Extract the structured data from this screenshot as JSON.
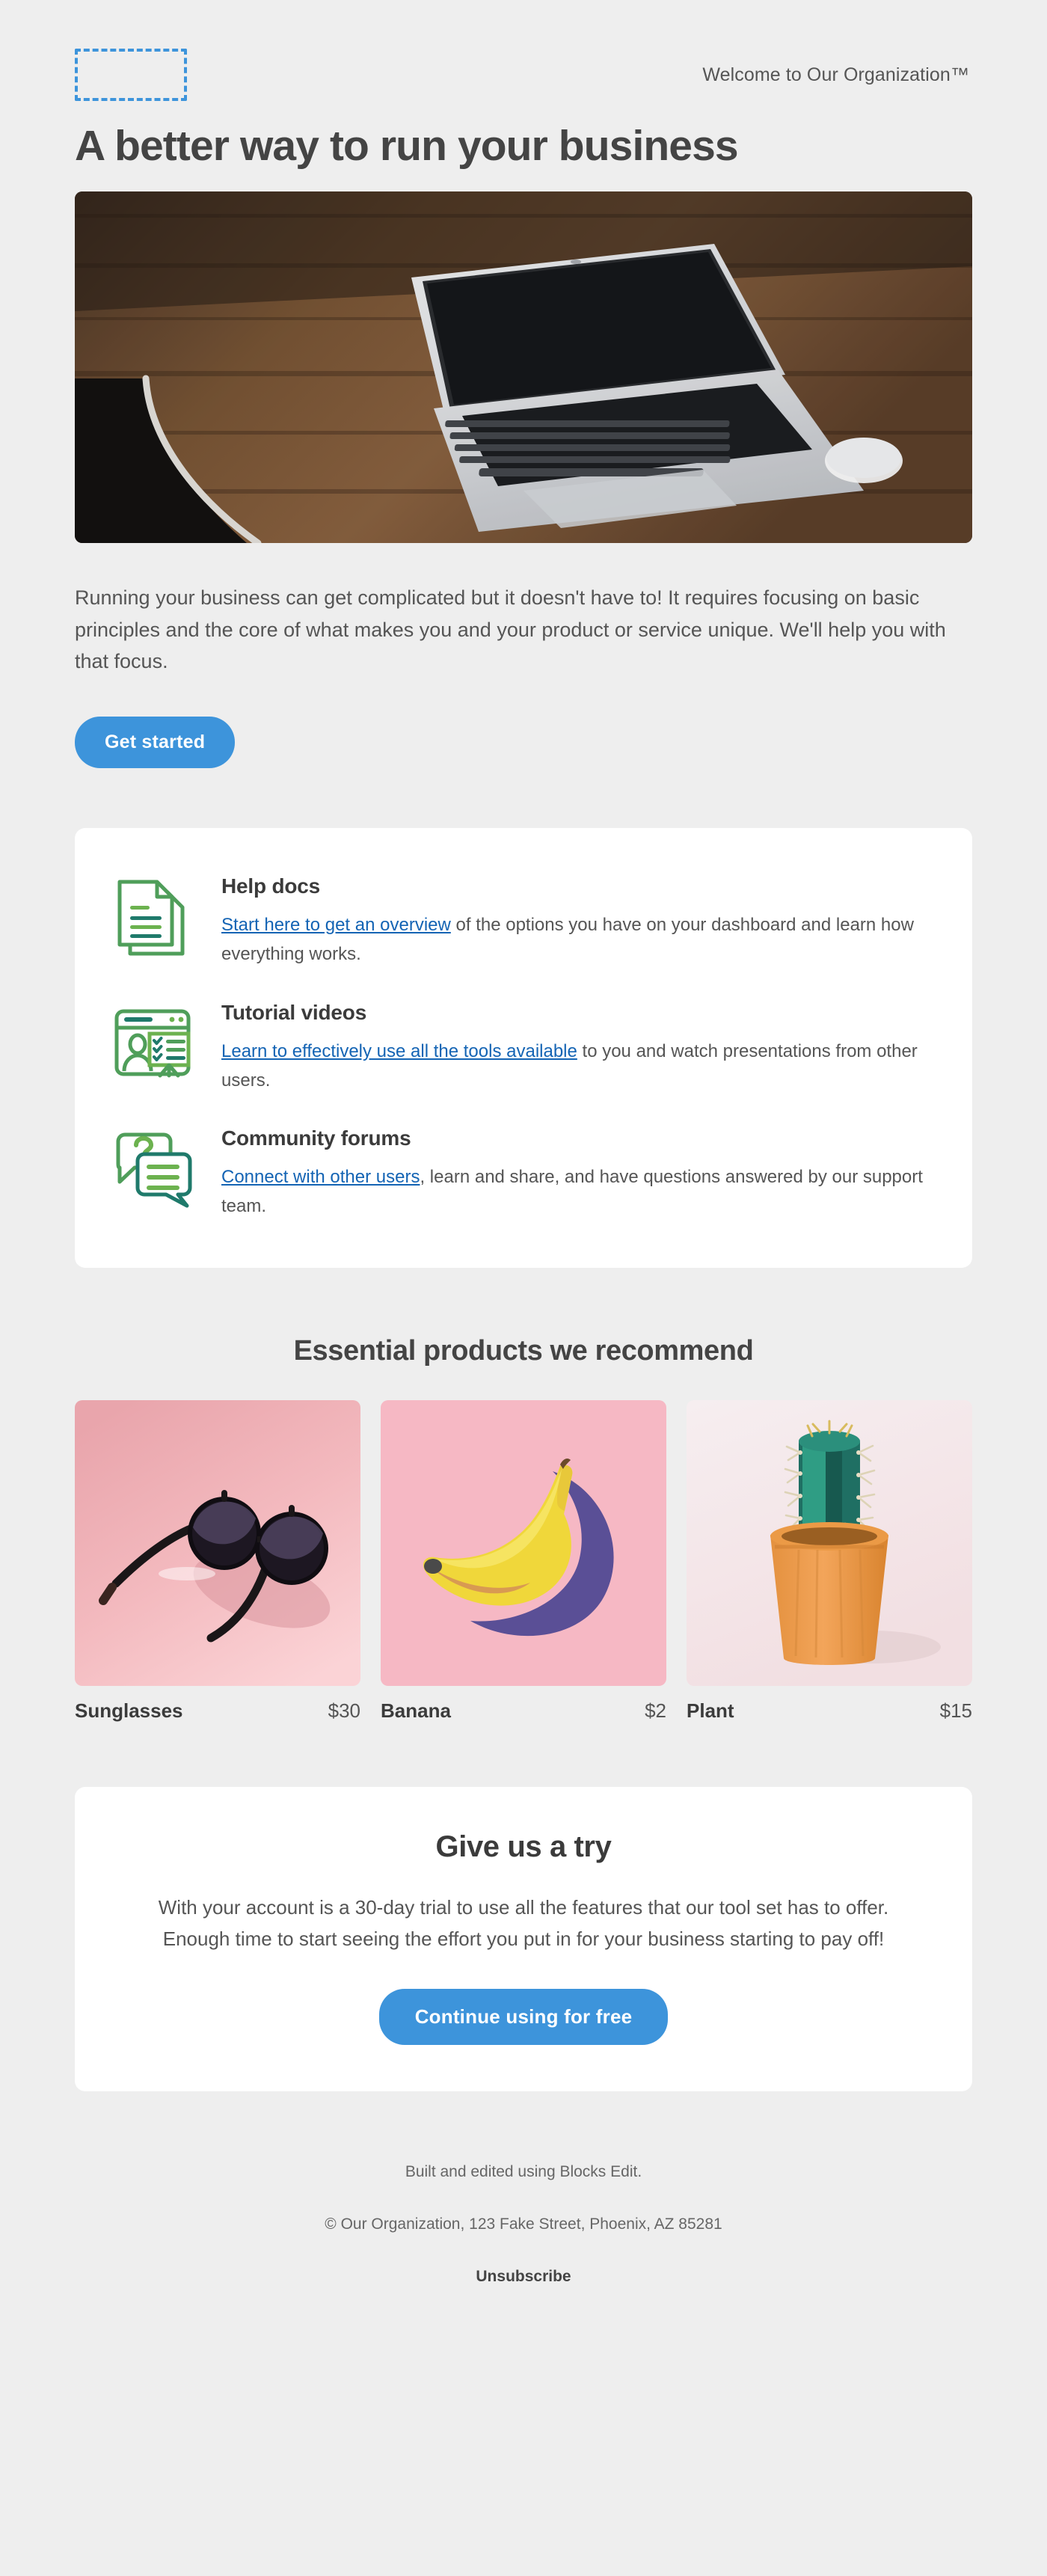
{
  "header": {
    "logo_placeholder_name": "logo-placeholder",
    "tagline": "Welcome to Our Organization™"
  },
  "hero": {
    "title": "A better way to run your business",
    "image_alt": "laptop-and-mouse-on-wooden-desk",
    "body": "Running your business can get complicated but it doesn't have to! It requires focusing on basic principles and the core of what makes you and your product or service unique. We'll help you with that focus.",
    "cta_label": "Get started"
  },
  "features": [
    {
      "icon": "documents-icon",
      "title": "Help docs",
      "link_text": "Start here to get an overview",
      "rest_text": " of the options you have on your dashboard and learn how everything works."
    },
    {
      "icon": "presentation-video-icon",
      "title": "Tutorial videos",
      "link_text": "Learn to effectively use all the tools available",
      "rest_text": " to you and watch presentations from other users."
    },
    {
      "icon": "chat-bubbles-icon",
      "title": "Community forums",
      "link_text": "Connect with other users",
      "rest_text": ", learn and share, and have questions answered by our support team."
    }
  ],
  "products_section": {
    "title": "Essential products we recommend",
    "items": [
      {
        "name": "Sunglasses",
        "price": "$30",
        "image_alt": "round-black-sunglasses-on-pink-background"
      },
      {
        "name": "Banana",
        "price": "$2",
        "image_alt": "banana-with-purple-shadow-on-pink-background"
      },
      {
        "name": "Plant",
        "price": "$15",
        "image_alt": "cactus-in-orange-pot-on-pink-background"
      }
    ]
  },
  "cta": {
    "title": "Give us a try",
    "text": "With your account is a 30-day trial to use all the features that our tool set has to offer. Enough time to start seeing the effort you put in for your business starting to pay off!",
    "button_label": "Continue using for free"
  },
  "footer": {
    "built_line": "Built and edited using Blocks Edit.",
    "copyright_line": "© Our Organization, 123 Fake Street, Phoenix, AZ 85281",
    "unsubscribe_label": "Unsubscribe"
  },
  "colors": {
    "page_background": "#eeeeee",
    "card_background": "#ffffff",
    "accent_blue": "#3d94db",
    "link_blue": "#1464b4",
    "heading_gray": "#444444",
    "body_gray": "#555555",
    "icon_green": "#4f9e5a",
    "icon_light_green": "#6cb24f",
    "icon_teal": "#1f7a6b"
  }
}
